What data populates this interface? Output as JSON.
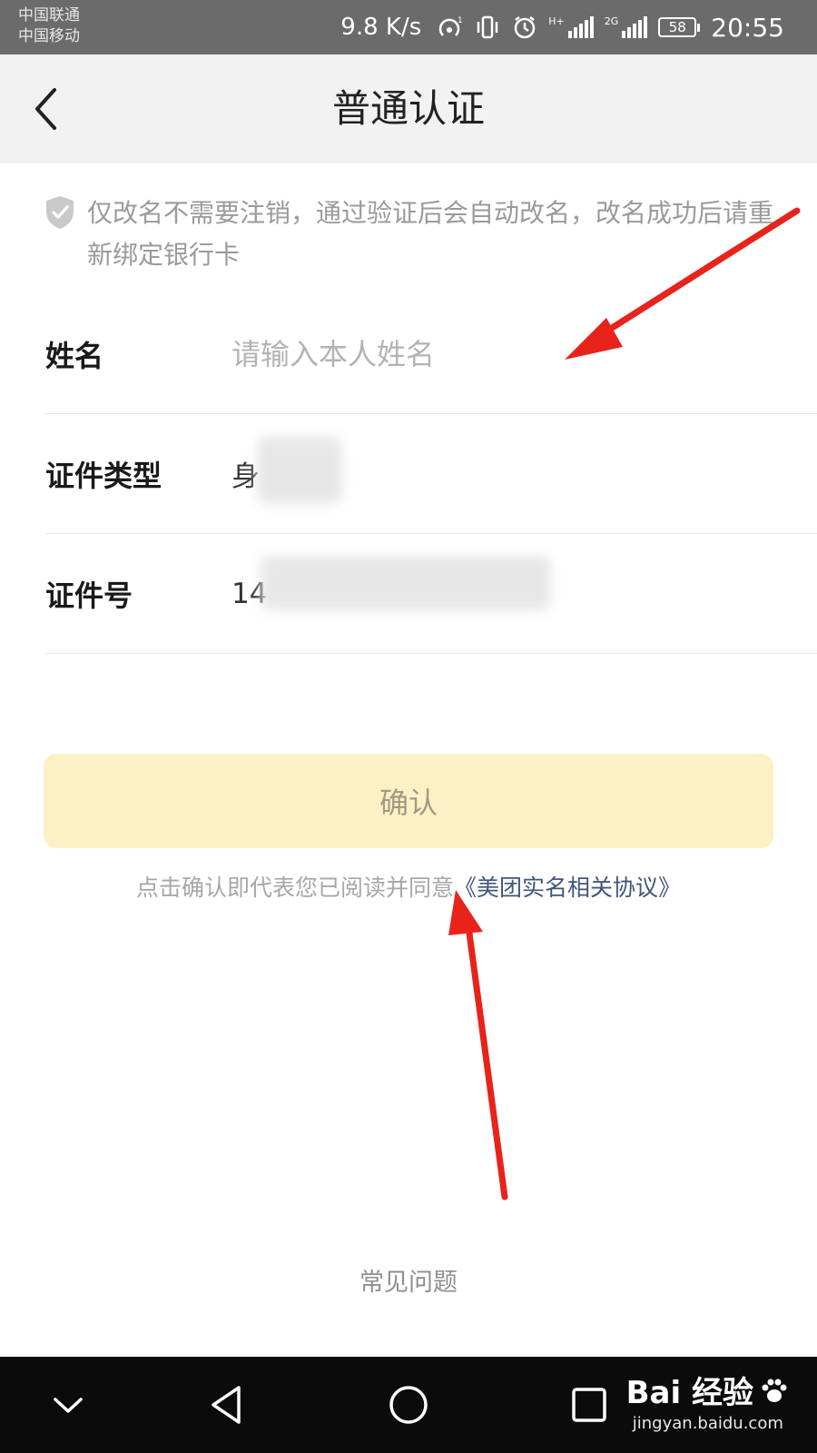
{
  "status_bar": {
    "carrier_1": "中国联通",
    "carrier_2": "中国移动",
    "speed": "9.8 K/s",
    "network_tag_1": "H+",
    "network_tag_2": "2G",
    "battery": "58",
    "time": "20:55"
  },
  "nav": {
    "title": "普通认证",
    "back_icon": "chevron-left-icon"
  },
  "notice": {
    "icon": "shield-check-icon",
    "text": "仅改名不需要注销，通过验证后会自动改名，改名成功后请重新绑定银行卡"
  },
  "form": {
    "name_label": "姓名",
    "name_placeholder": "请输入本人姓名",
    "id_type_label": "证件类型",
    "id_type_value": "身",
    "id_number_label": "证件号",
    "id_number_value": "14"
  },
  "confirm_label": "确认",
  "agreement": {
    "prefix": "点击确认即代表您已阅读并同意",
    "link": "《美团实名相关协议》"
  },
  "faq_label": "常见问题",
  "system_nav": {
    "icons": [
      "chevron-down-icon",
      "back-triangle-icon",
      "home-circle-icon",
      "recents-square-icon"
    ]
  },
  "watermark": {
    "brand": "Bai 经验",
    "url": "jingyan.baidu.com"
  },
  "colors": {
    "nav_background": "#f2f2f2",
    "confirm_background": "#fcf1c4",
    "link": "#43557a",
    "annotation_arrow": "#e8231c"
  }
}
